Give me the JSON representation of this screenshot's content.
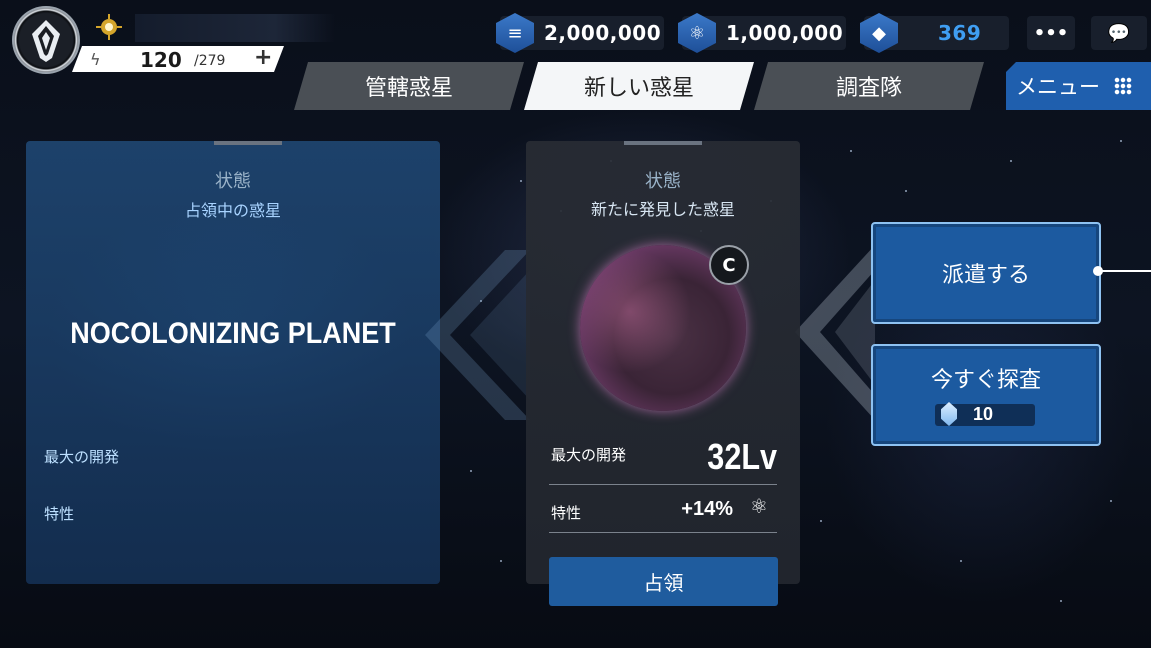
{
  "player": {
    "energy_current": "120",
    "energy_max": "/279",
    "energy_add": "+"
  },
  "resources": [
    {
      "icon": "stack-icon",
      "value": "2,000,000"
    },
    {
      "icon": "molecule-icon",
      "value": "1,000,000"
    },
    {
      "icon": "crystal-icon",
      "value": "369",
      "color": "#3f9ef2"
    }
  ],
  "top_buttons": {
    "more": "•••",
    "chat": "chat-icon"
  },
  "tabs": [
    {
      "label": "管轄惑星",
      "active": false
    },
    {
      "label": "新しい惑星",
      "active": true
    },
    {
      "label": "調査隊",
      "active": false
    }
  ],
  "menu": {
    "label": "メニュー"
  },
  "left_panel": {
    "state_label": "状態",
    "state_value": "占領中の惑星",
    "planet_name": "NOCOLONIZING PLANET",
    "max_dev_label": "最大の開発",
    "trait_label": "特性"
  },
  "mid_panel": {
    "state_label": "状態",
    "state_value": "新たに発見した惑星",
    "max_dev_label": "最大の開発",
    "max_dev_value": "32Lv",
    "trait_label": "特性",
    "trait_value": "+14%",
    "occupy_button": "占領"
  },
  "actions": {
    "dispatch": "派遣する",
    "explore": "今すぐ探査",
    "explore_cost": "10"
  },
  "colors": {
    "accent_blue": "#1f5fae",
    "gem_text": "#3f9ef2"
  }
}
